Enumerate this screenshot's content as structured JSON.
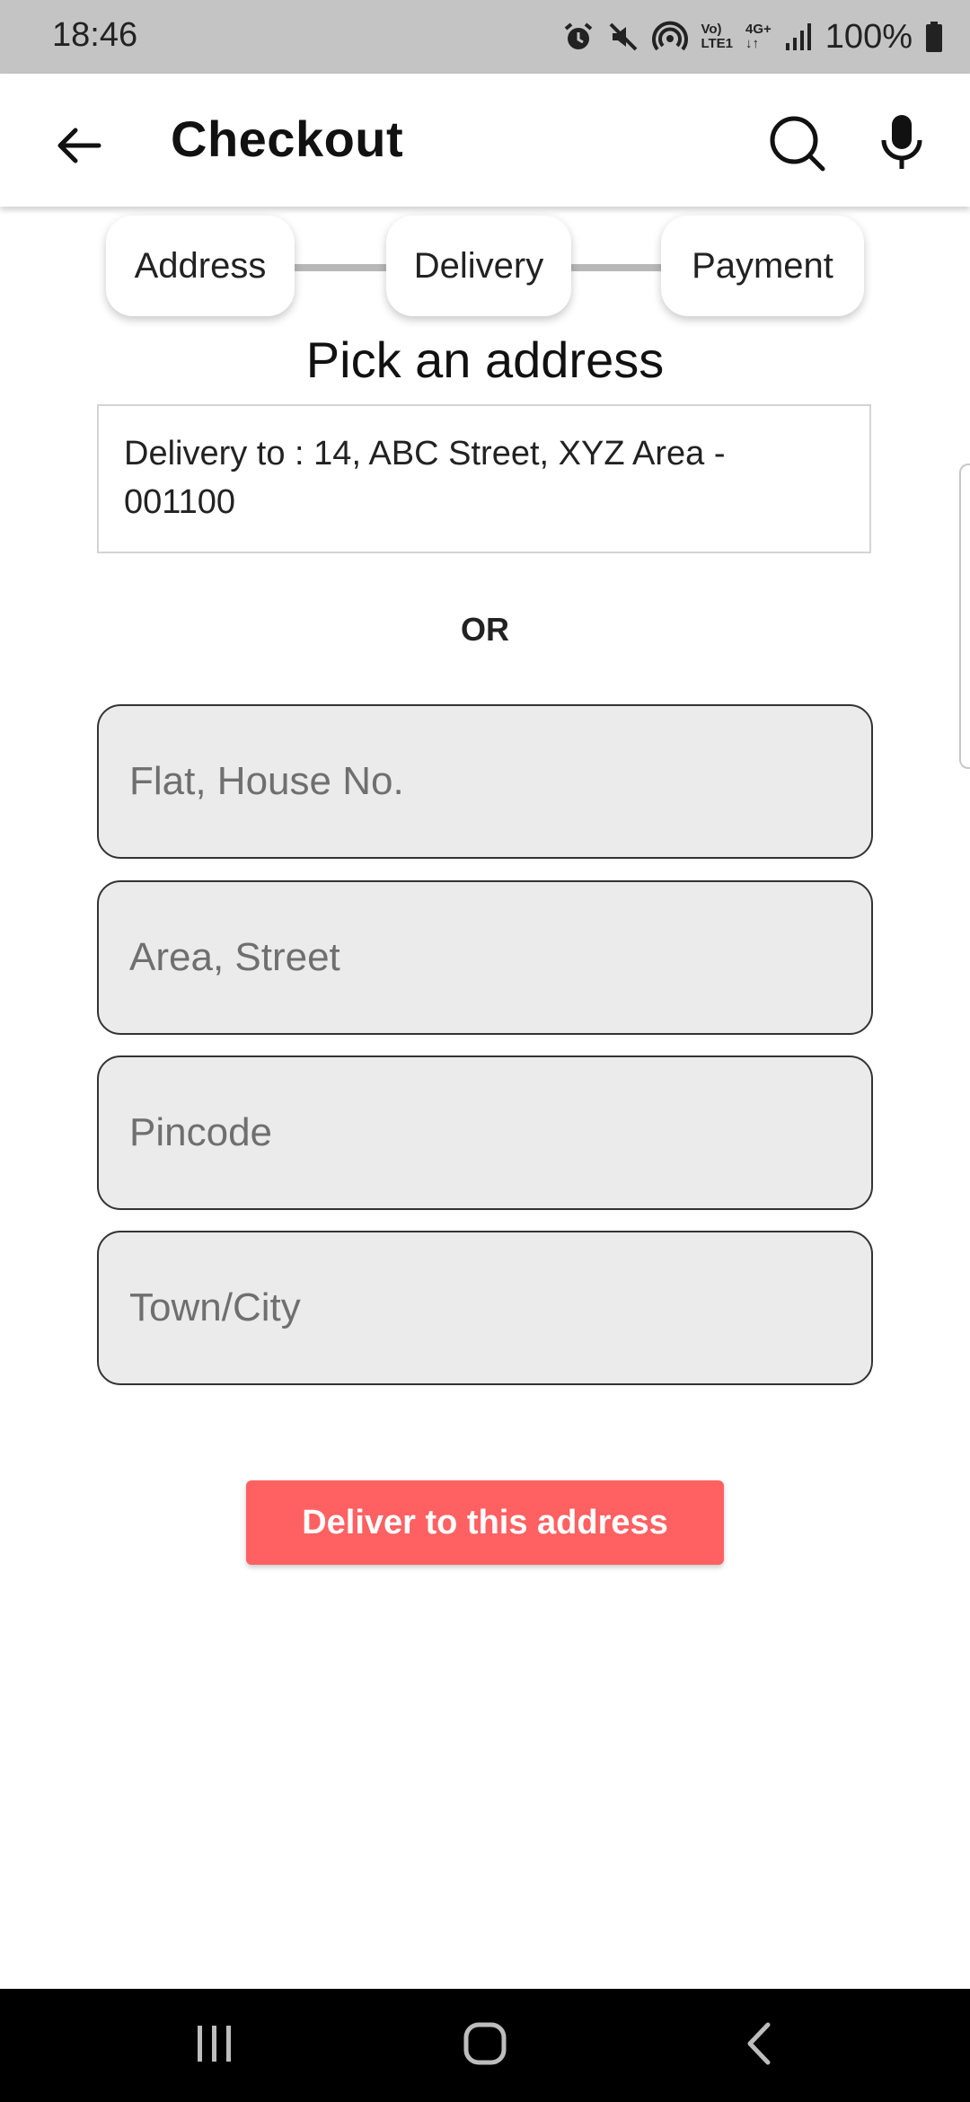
{
  "status_bar": {
    "time": "18:46",
    "battery": "100%",
    "icons": [
      "alarm-icon",
      "mute-icon",
      "hotspot-icon",
      "volte-icon",
      "4g-icon",
      "signal-icon",
      "battery-icon"
    ],
    "network_top": "Vo)",
    "network_bottom": "LTE1",
    "data_type": "4G+"
  },
  "app_bar": {
    "title": "Checkout",
    "icons": [
      "back-arrow-icon",
      "search-icon",
      "mic-icon"
    ]
  },
  "stepper": {
    "steps": [
      "Address",
      "Delivery",
      "Payment"
    ]
  },
  "main": {
    "section_title": "Pick an address",
    "saved_address": "Delivery to : 14, ABC Street, XYZ Area - 001100",
    "or_label": "OR",
    "fields": [
      {
        "placeholder": "Flat, House No.",
        "value": ""
      },
      {
        "placeholder": "Area, Street",
        "value": ""
      },
      {
        "placeholder": "Pincode",
        "value": ""
      },
      {
        "placeholder": "Town/City",
        "value": ""
      }
    ],
    "cta_label": "Deliver to this address"
  },
  "colors": {
    "accent": "#ff6163",
    "status_bar_bg": "#c4c4c4",
    "field_bg": "#ebebeb",
    "nav_bar_bg": "#000000"
  },
  "nav_bar": {
    "icons": [
      "recent-apps-icon",
      "home-icon",
      "back-icon"
    ]
  }
}
